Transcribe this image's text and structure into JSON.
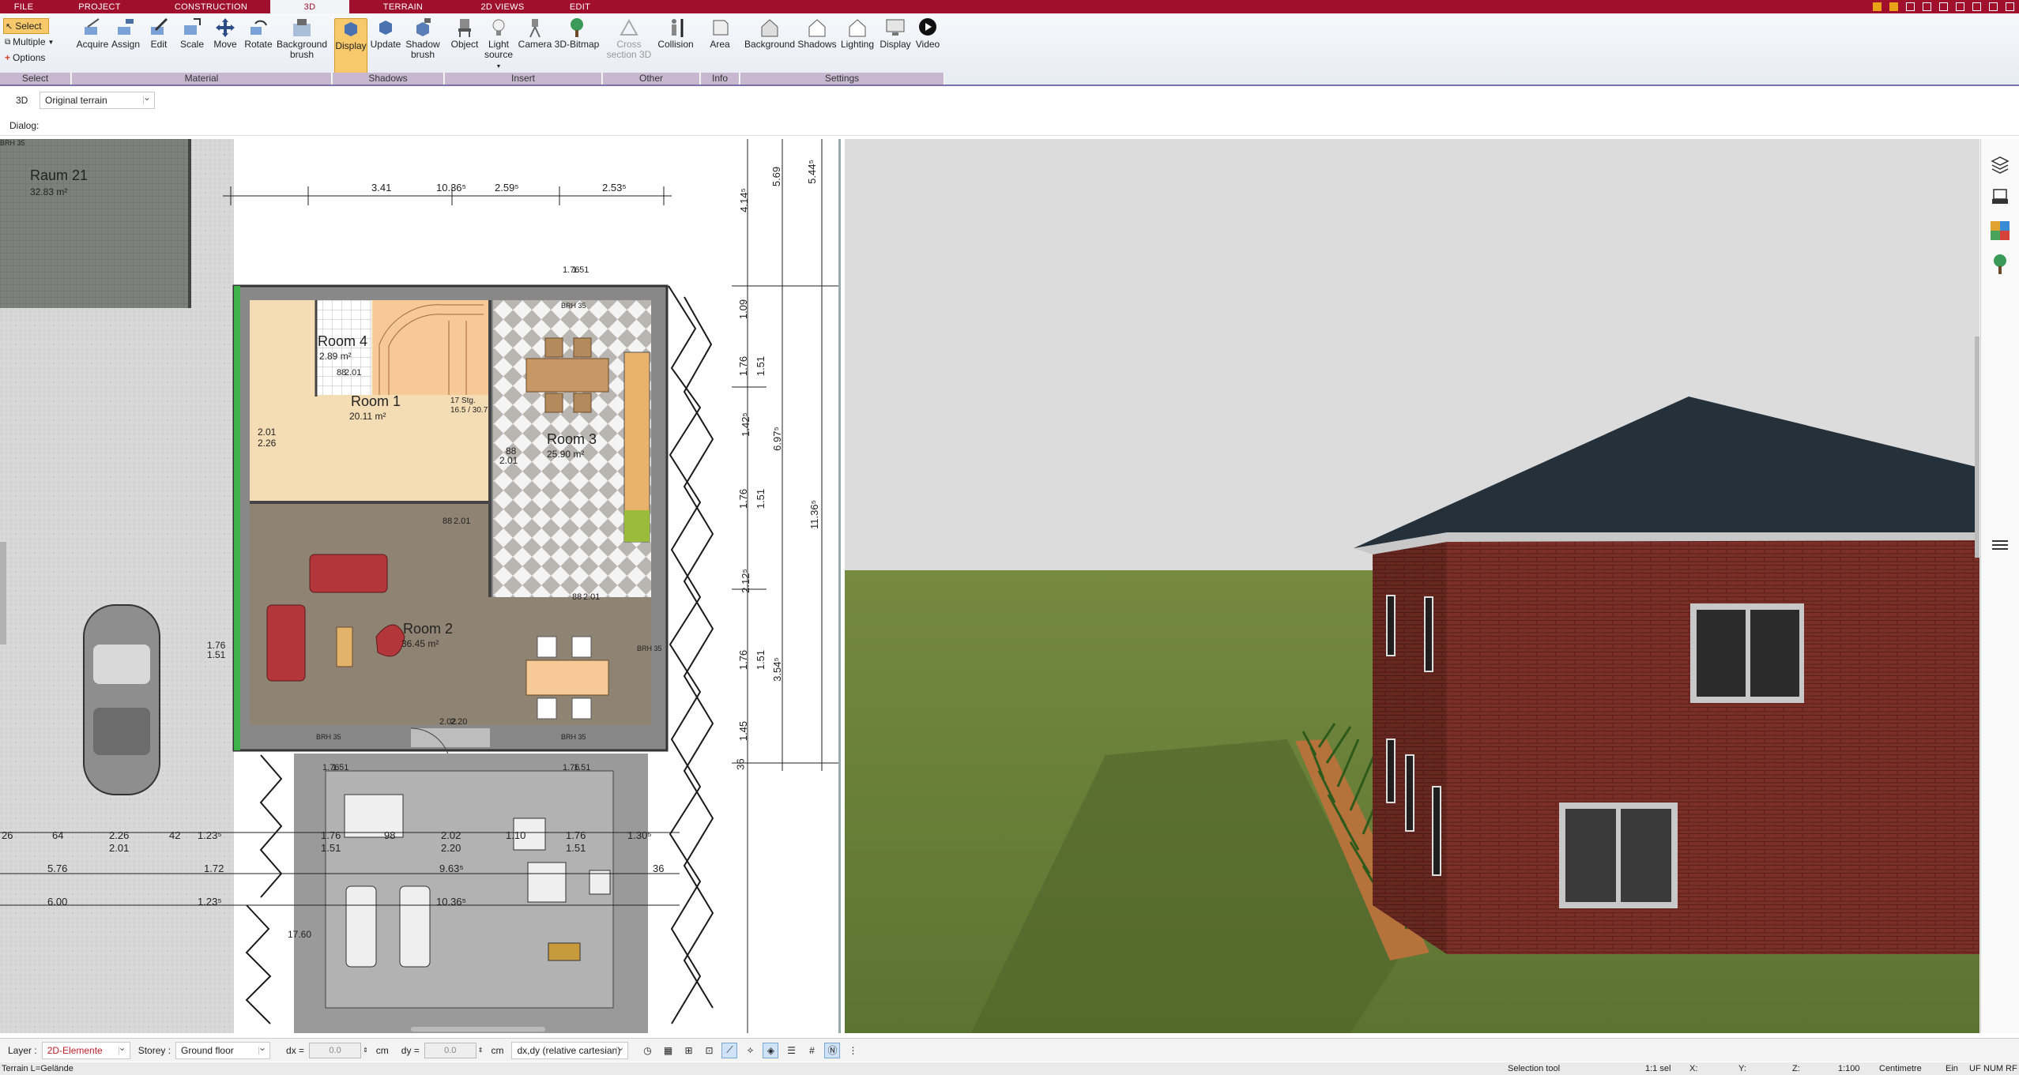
{
  "tabs": [
    {
      "label": "FILE",
      "active": false
    },
    {
      "label": "PROJECT",
      "active": false
    },
    {
      "label": "CONSTRUCTION",
      "active": false
    },
    {
      "label": "3D",
      "active": true
    },
    {
      "label": "TERRAIN",
      "active": false
    },
    {
      "label": "2D VIEWS",
      "active": false
    },
    {
      "label": "EDIT",
      "active": false
    }
  ],
  "ribbon": {
    "select": {
      "select": "Select",
      "multiple": "Multiple",
      "options": "Options",
      "group": "Select"
    },
    "material": {
      "acquire": "Acquire",
      "assign": "Assign",
      "edit": "Edit",
      "scale": "Scale",
      "move": "Move",
      "rotate": "Rotate",
      "background_brush_1": "Background",
      "background_brush_2": "brush",
      "group": "Material"
    },
    "shadows": {
      "display": "Display",
      "update": "Update",
      "shadow_brush_1": "Shadow",
      "shadow_brush_2": "brush",
      "group": "Shadows"
    },
    "insert": {
      "object": "Object",
      "light_1": "Light",
      "light_2": "source",
      "camera": "Camera",
      "bitmap": "3D-Bitmap",
      "group": "Insert"
    },
    "other": {
      "cross_1": "Cross",
      "cross_2": "section 3D",
      "collision": "Collision",
      "group": "Other"
    },
    "info": {
      "area": "Area",
      "group": "Info"
    },
    "settings": {
      "background": "Background",
      "shadows": "Shadows",
      "lighting": "Lighting",
      "display": "Display",
      "video": "Video",
      "group": "Settings"
    }
  },
  "view_row": {
    "label": "3D",
    "terrain": "Original terrain"
  },
  "dialog_row": {
    "label": "Dialog:"
  },
  "plan": {
    "rooms": [
      {
        "name": "Raum 21",
        "area": "32.83 m²"
      },
      {
        "name": "Room 4",
        "area": "2.89 m²"
      },
      {
        "name": "Room 1",
        "area": "20.11 m²"
      },
      {
        "name": "Room 3",
        "area": "25.90 m²"
      },
      {
        "name": "Room 2",
        "area": "36.45 m²"
      }
    ],
    "dims_top": [
      "3.41",
      "10.36⁵",
      "2.59⁵",
      "2.53⁵"
    ],
    "dims_right": [
      "5.69",
      "5.44⁵",
      "4.14⁵",
      "1.09",
      "1.76",
      "1.51",
      "1.42⁵",
      "6.97⁵",
      "11.36⁵",
      "1.76",
      "1.51",
      "2.12⁵",
      "1.76",
      "1.51",
      "3.54⁵",
      "1.45",
      "36"
    ],
    "dims_bottom_row1": [
      "26",
      "64",
      "2.26",
      "42",
      "1.23⁵",
      "1.76",
      "98",
      "2.02",
      "1.10",
      "1.76",
      "1.30⁵"
    ],
    "dims_bottom_row1b": [
      "2.01",
      "1.51",
      "2.20",
      "1.51"
    ],
    "dims_bottom_row2": [
      "5.76",
      "1.72",
      "9.63⁵",
      "36"
    ],
    "dims_bottom_row3": [
      "6.00",
      "1.23⁵",
      "10.36⁵"
    ],
    "misc": [
      "2.01",
      "2.26",
      "88",
      "2.01",
      "88",
      "2.01",
      "88",
      "2.01",
      "88",
      "2.01",
      "1.76",
      "1.51",
      "17 Stg.",
      "16.5 / 30.7",
      "BRH 35",
      "BRH 35",
      "BRH 35",
      "BRH 35",
      "BRH 35",
      "2.02",
      "2.20",
      "1.76",
      "1.51",
      "17.60",
      "1.76",
      "1.51",
      "1.51",
      "1.76"
    ]
  },
  "status": {
    "layer_label": "Layer :",
    "layer_value": "2D-Elemente",
    "storey_label": "Storey :",
    "storey_value": "Ground floor",
    "dx_label": "dx =",
    "dx_value": "0.0",
    "dx_unit": "cm",
    "dy_label": "dy =",
    "dy_value": "0.0",
    "dy_unit": "cm",
    "coord_mode": "dx,dy (relative cartesian)"
  },
  "bottom": {
    "left": "Terrain L=Gelände",
    "tool": "Selection tool",
    "sel": "1:1 sel",
    "x": "X:",
    "y": "Y:",
    "z": "Z:",
    "scale": "1:100",
    "unit": "Centimetre",
    "ein": "Ein",
    "uf": "UF",
    "num": "NUM",
    "rf": "RF"
  },
  "colors": {
    "tabbar": "#a0102c",
    "group_label": "#c7b8cf",
    "active_button": "#f7c96a"
  }
}
